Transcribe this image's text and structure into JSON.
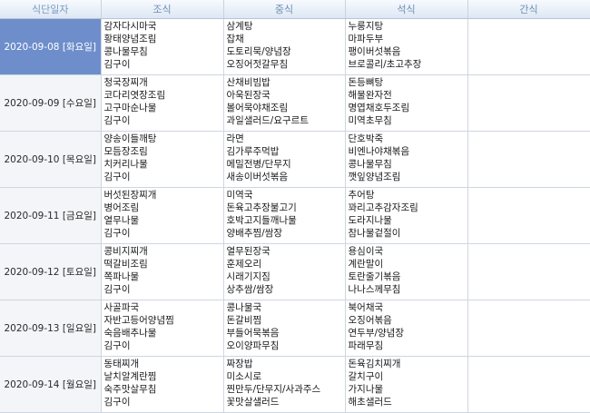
{
  "headers": [
    "식단일자",
    "조식",
    "중식",
    "석식",
    "간식"
  ],
  "rows": [
    {
      "date": "2020-09-08 [화요일]",
      "selected": true,
      "breakfast": [
        "감자다시마국",
        "황태양념조림",
        "콩나물무침",
        "김구이"
      ],
      "lunch": [
        "삼계탕",
        "잡채",
        "도토리묵/양념장",
        "오징어젓갈무침"
      ],
      "dinner": [
        "누룽지탕",
        "마파두부",
        "팽이버섯볶음",
        "브로콜리/초고추장"
      ],
      "snack": []
    },
    {
      "date": "2020-09-09 [수요일]",
      "selected": false,
      "breakfast": [
        "청국장찌개",
        "코다리엿장조림",
        "고구마순나물",
        "김구이"
      ],
      "lunch": [
        "산채비빔밥",
        "아욱된장국",
        "볼어묵야채조림",
        "과일샐러드/요구르트"
      ],
      "dinner": [
        "돈등뼈탕",
        "해물완자전",
        "명엽채호두조림",
        "미역초무침"
      ],
      "snack": []
    },
    {
      "date": "2020-09-10 [목요일]",
      "selected": false,
      "breakfast": [
        "양송이들깨탕",
        "모듬장조림",
        "치커리나물",
        "김구이"
      ],
      "lunch": [
        "라면",
        "김가루주먹밥",
        "메밀전병/단무지",
        "새송이버섯볶음"
      ],
      "dinner": [
        "단호박죽",
        "비엔나야채볶음",
        "콩나물무침",
        "깻잎양념조림"
      ],
      "snack": []
    },
    {
      "date": "2020-09-11 [금요일]",
      "selected": false,
      "breakfast": [
        "버섯된장찌개",
        "병어조림",
        "열무나물",
        "김구이"
      ],
      "lunch": [
        "미역국",
        "돈육고추장불고기",
        "호박고지들깨나물",
        "양배추찜/쌈장"
      ],
      "dinner": [
        "추어탕",
        "꽈리고추감자조림",
        "도라지나물",
        "참나물겉절이"
      ],
      "snack": []
    },
    {
      "date": "2020-09-12 [토요일]",
      "selected": false,
      "breakfast": [
        "콩비지찌개",
        "떡갈비조림",
        "쪽파나물",
        "김구이"
      ],
      "lunch": [
        "열무된장국",
        "훈제오리",
        "시래기지짐",
        "상추쌈/쌈장"
      ],
      "dinner": [
        "용심이국",
        "계란말이",
        "토란줄기볶음",
        "나나스께무침"
      ],
      "snack": []
    },
    {
      "date": "2020-09-13 [일요일]",
      "selected": false,
      "breakfast": [
        "사골파국",
        "자반고등어양념찜",
        "숙음배추나물",
        "김구이"
      ],
      "lunch": [
        "콩나물국",
        "돈갈비찜",
        "부들어묵볶음",
        "오이양파무침"
      ],
      "dinner": [
        "북어채국",
        "오징어볶음",
        "연두부/양념장",
        "파래무침"
      ],
      "snack": []
    },
    {
      "date": "2020-09-14 [월요일]",
      "selected": false,
      "breakfast": [
        "동태찌개",
        "날치알계란찜",
        "숙주맛살무침",
        "김구이"
      ],
      "lunch": [
        "짜장밥",
        "미소시로",
        "찐만두/단무지/사과주스",
        "꽃맛살샐러드"
      ],
      "dinner": [
        "돈육김치찌개",
        "갈치구이",
        "가지나물",
        "해초샐러드"
      ],
      "snack": []
    }
  ]
}
